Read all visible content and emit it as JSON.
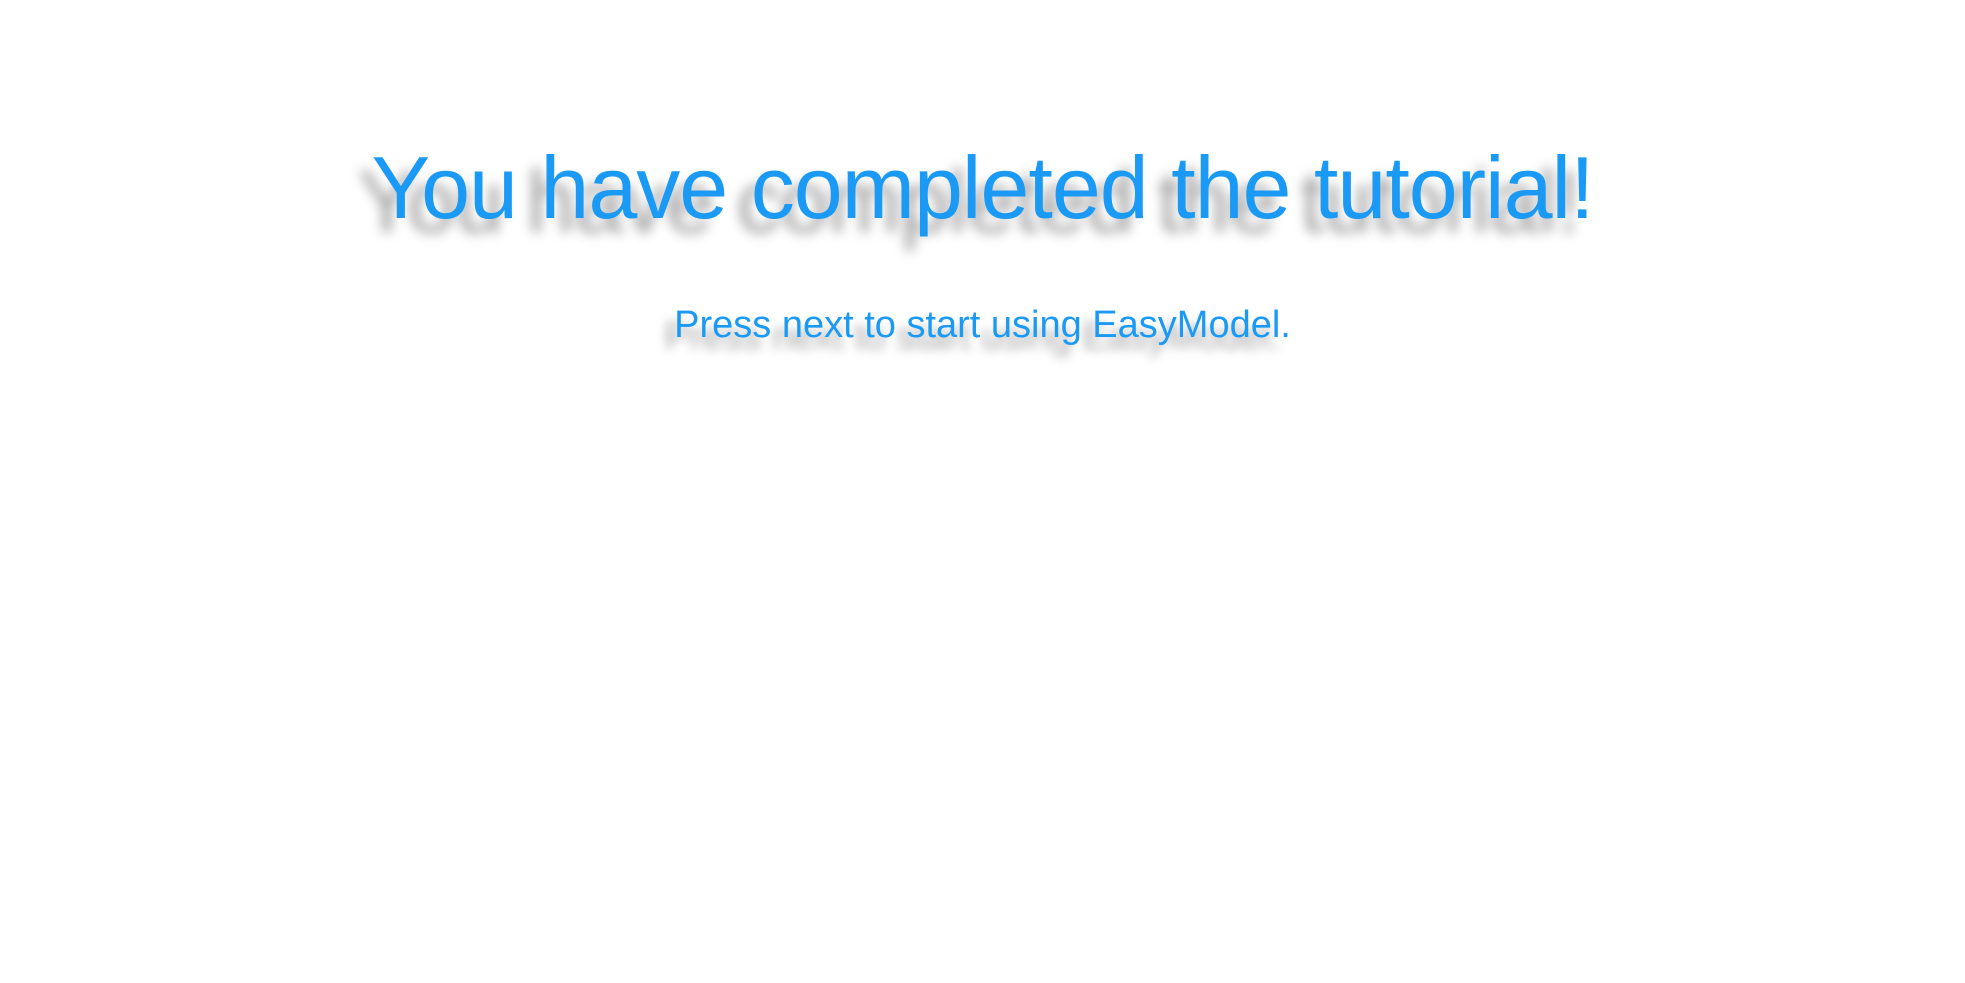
{
  "tutorial_end": {
    "title": "You have completed the tutorial!",
    "subtitle": "Press next to start using EasyModel."
  },
  "colors": {
    "background": "#ffffff",
    "accent_text": "#1a9af5",
    "shadow": "rgba(0,0,0,0.38)"
  }
}
